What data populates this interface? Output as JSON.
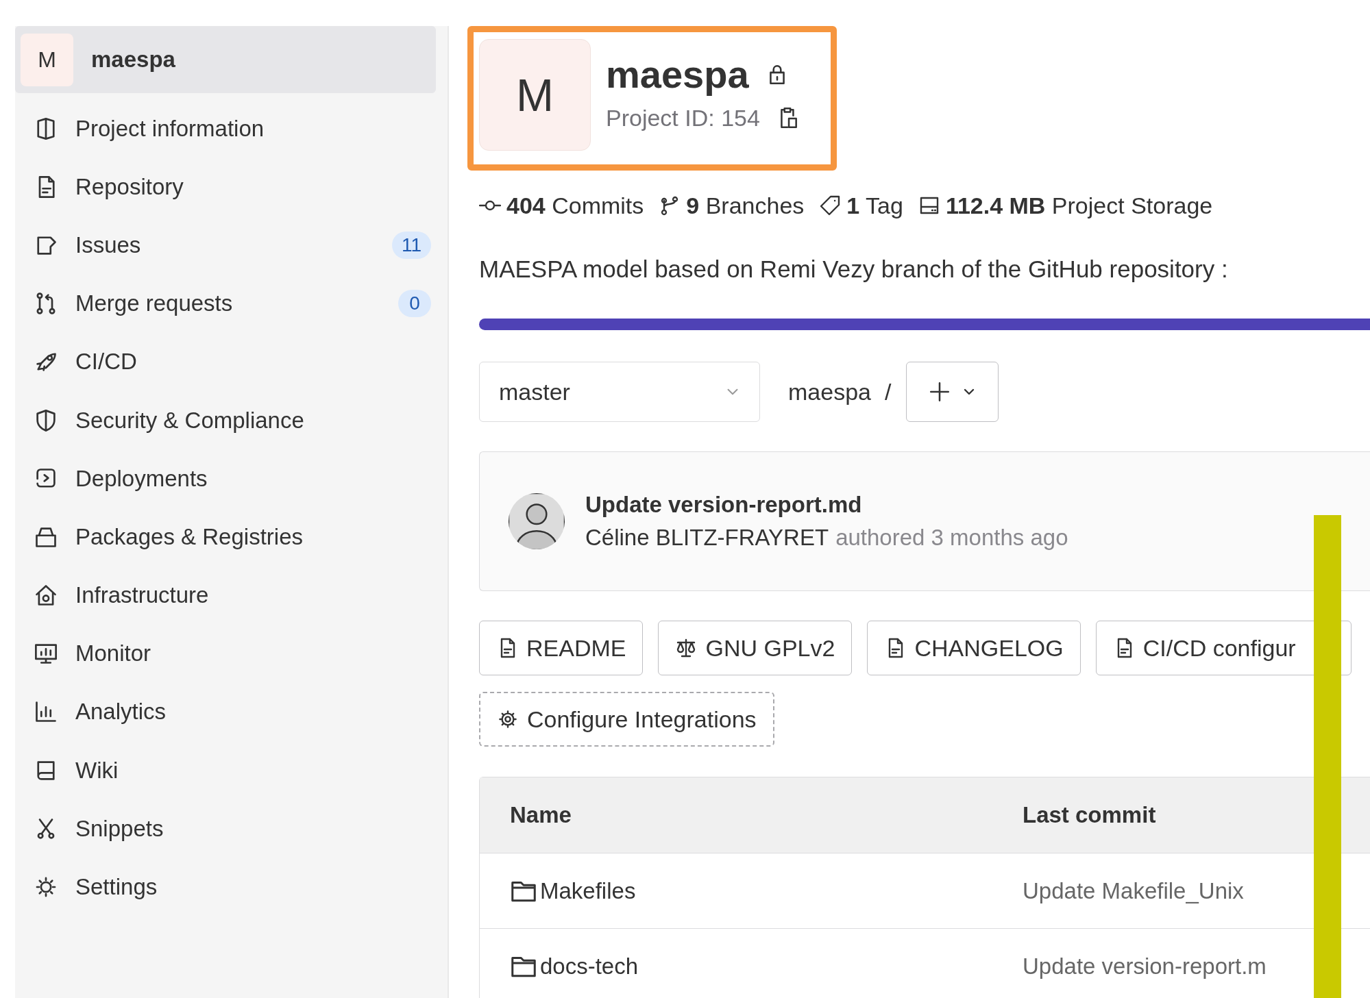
{
  "sidebar": {
    "project": {
      "avatar": "M",
      "name": "maespa",
      "selected": true
    },
    "items": [
      {
        "label": "Project information",
        "selected": false
      },
      {
        "label": "Repository",
        "selected": false
      },
      {
        "label": "Issues",
        "badge": "11",
        "selected": false
      },
      {
        "label": "Merge requests",
        "badge": "0",
        "selected": false
      },
      {
        "label": "CI/CD",
        "selected": false
      },
      {
        "label": "Security & Compliance",
        "selected": false
      },
      {
        "label": "Deployments",
        "selected": false
      },
      {
        "label": "Packages & Registries",
        "selected": false
      },
      {
        "label": "Infrastructure",
        "selected": false
      },
      {
        "label": "Monitor",
        "selected": false
      },
      {
        "label": "Analytics",
        "selected": false
      },
      {
        "label": "Wiki",
        "selected": false
      },
      {
        "label": "Snippets",
        "selected": false
      },
      {
        "label": "Settings",
        "selected": false
      }
    ]
  },
  "project": {
    "avatar": "M",
    "name": "maespa",
    "project_id": "Project ID: 154"
  },
  "stats": [
    "**404** Commits",
    "**9** Branches",
    "**1** Tag",
    "**112.4 MB** Project Storage"
  ],
  "description": "MAESPA model based on Remi Vezy branch of the GitHub repository :",
  "branch_selector": {
    "value": "master"
  },
  "breadcrumb": "maespa",
  "breadcrumb_separator": "/",
  "last_commit": {
    "title": "Update version-report.md",
    "author": "Céline BLITZ-FRAYRET",
    "time": "authored 3 months ago"
  },
  "quick_links": [
    {
      "label": "README",
      "kind": "document"
    },
    {
      "label": "GNU GPLv2",
      "kind": "license"
    },
    {
      "label": "CHANGELOG",
      "kind": "document"
    },
    {
      "label": "CI/CD configur",
      "kind": "document"
    }
  ],
  "configure_integrations": "Configure Integrations",
  "table": {
    "columns": [
      "Name",
      "Last commit"
    ],
    "rows": [
      {
        "name": "Makefiles",
        "last_commit": "Update Makefile_Unix"
      },
      {
        "name": "docs-tech",
        "last_commit": "Update version-report.m"
      }
    ]
  }
}
